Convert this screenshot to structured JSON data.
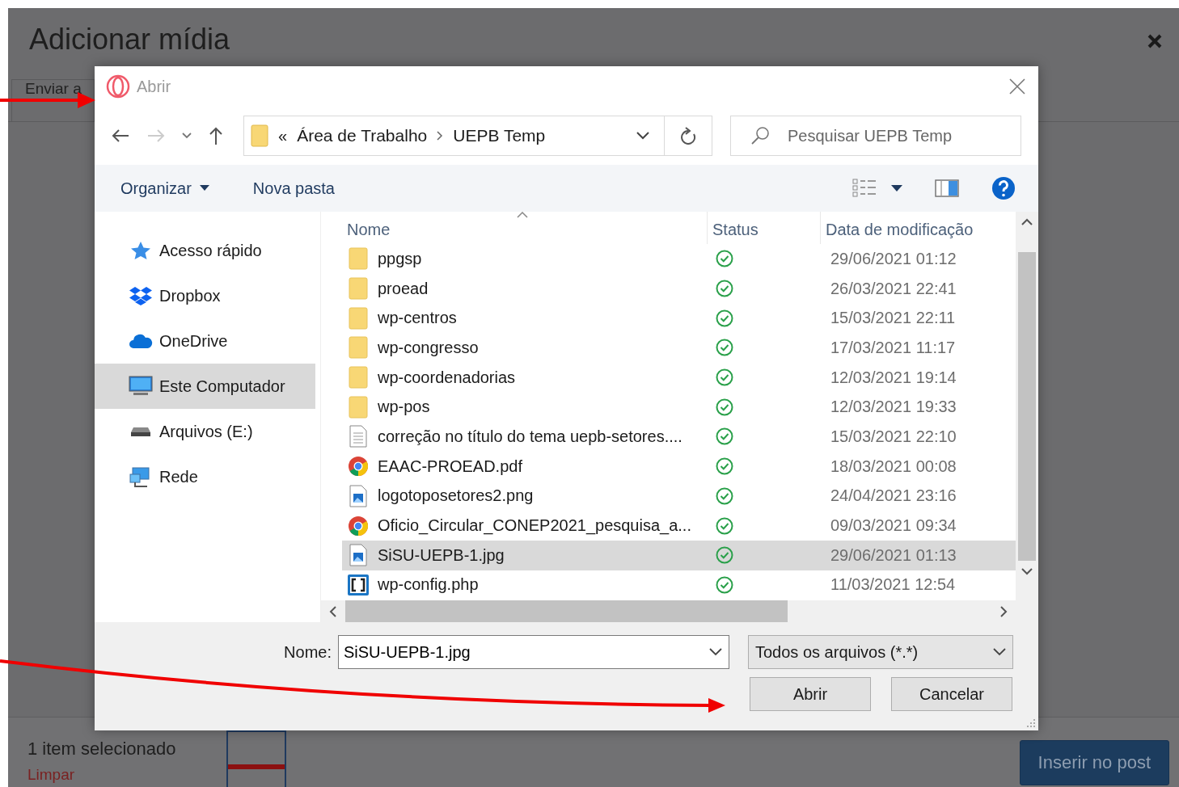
{
  "page": {
    "title": "Adicionar mídia",
    "tab": "Enviar a",
    "selection_count": "1 item selecionado",
    "clear_link": "Limpar",
    "insert_button": "Inserir no post"
  },
  "dialog": {
    "title": "Abrir",
    "breadcrumb": {
      "overflow": "«",
      "items": [
        "Área de Trabalho",
        "UEPB Temp"
      ]
    },
    "search": {
      "placeholder": "Pesquisar UEPB Temp"
    },
    "toolbar": {
      "organize": "Organizar",
      "new_folder": "Nova pasta"
    },
    "nav": [
      {
        "label": "Acesso rápido",
        "kind": "star",
        "selected": false
      },
      {
        "label": "Dropbox",
        "kind": "dropbox",
        "selected": false
      },
      {
        "label": "OneDrive",
        "kind": "cloud",
        "selected": false
      },
      {
        "label": "Este Computador",
        "kind": "computer",
        "selected": true
      },
      {
        "label": "Arquivos (E:)",
        "kind": "drive",
        "selected": false
      },
      {
        "label": "Rede",
        "kind": "network",
        "selected": false
      }
    ],
    "columns": [
      "Nome",
      "Status",
      "Data de modificação"
    ],
    "files": [
      {
        "name": "ppgsp",
        "kind": "folder",
        "date": "29/06/2021 01:12",
        "selected": false
      },
      {
        "name": "proead",
        "kind": "folder",
        "date": "26/03/2021 22:41",
        "selected": false
      },
      {
        "name": "wp-centros",
        "kind": "folder",
        "date": "15/03/2021 22:11",
        "selected": false
      },
      {
        "name": "wp-congresso",
        "kind": "folder",
        "date": "17/03/2021 11:17",
        "selected": false
      },
      {
        "name": "wp-coordenadorias",
        "kind": "folder",
        "date": "12/03/2021 19:14",
        "selected": false
      },
      {
        "name": "wp-pos",
        "kind": "folder",
        "date": "12/03/2021 19:33",
        "selected": false
      },
      {
        "name": "correção no título do tema uepb-setores....",
        "kind": "text",
        "date": "15/03/2021 22:10",
        "selected": false
      },
      {
        "name": "EAAC-PROEAD.pdf",
        "kind": "chrome",
        "date": "18/03/2021 00:08",
        "selected": false
      },
      {
        "name": "logotoposetores2.png",
        "kind": "image",
        "date": "24/04/2021 23:16",
        "selected": false
      },
      {
        "name": "Oficio_Circular_CONEP2021_pesquisa_a...",
        "kind": "chrome",
        "date": "09/03/2021 09:34",
        "selected": false
      },
      {
        "name": "SiSU-UEPB-1.jpg",
        "kind": "image",
        "date": "29/06/2021 01:13",
        "selected": true
      },
      {
        "name": "wp-config.php",
        "kind": "code",
        "date": "11/03/2021 12:54",
        "selected": false
      }
    ],
    "file_name": {
      "label": "Nome:",
      "value": "SiSU-UEPB-1.jpg"
    },
    "file_type": "Todos os arquivos (*.*)",
    "buttons": [
      "Abrir",
      "Cancelar"
    ]
  }
}
